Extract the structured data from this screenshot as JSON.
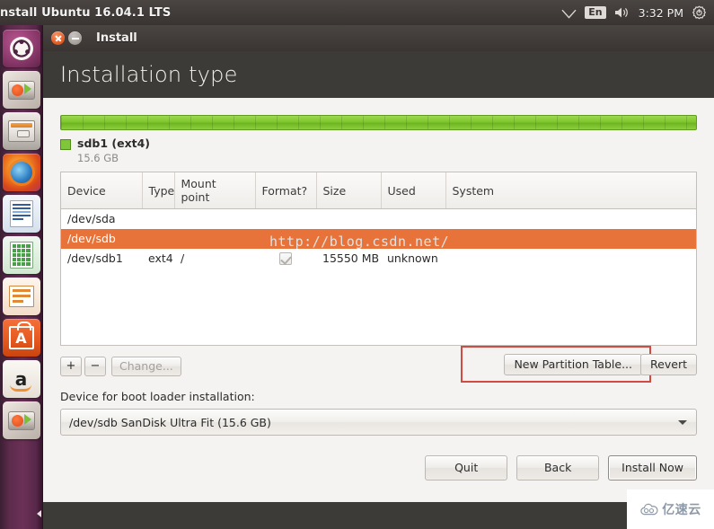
{
  "top_panel": {
    "title": "nstall Ubuntu 16.04.1 LTS",
    "tray": {
      "network_icon": "wifi-icon",
      "keyboard_layout": "En",
      "volume_icon": "volume-icon",
      "clock": "3:32 PM",
      "system_menu_icon": "gear-power-icon"
    }
  },
  "launcher": {
    "items": [
      {
        "name": "ubuntu-dash",
        "label": "Dash home",
        "glyph": "●"
      },
      {
        "name": "install-ubuntu",
        "label": "Install Ubuntu 16.04.1 LTS"
      },
      {
        "name": "files",
        "label": "Files"
      },
      {
        "name": "firefox",
        "label": "Firefox Web Browser"
      },
      {
        "name": "libreoffice-writer",
        "label": "LibreOffice Writer"
      },
      {
        "name": "libreoffice-calc",
        "label": "LibreOffice Calc"
      },
      {
        "name": "libreoffice-impress",
        "label": "LibreOffice Impress"
      },
      {
        "name": "ubuntu-software",
        "label": "Ubuntu Software",
        "glyph": "A"
      },
      {
        "name": "amazon",
        "label": "Amazon",
        "glyph": "a"
      },
      {
        "name": "install-ubuntu-running",
        "label": "Install"
      }
    ]
  },
  "window": {
    "title": "Install",
    "close_icon": "close-icon",
    "minimize_icon": "minimize-icon",
    "page_title": "Installation type"
  },
  "partition_bar": {
    "legend_name": "sdb1 (ext4)",
    "legend_size": "15.6 GB",
    "color": "#7fc63a"
  },
  "table": {
    "headers": [
      "Device",
      "Type",
      "Mount point",
      "Format?",
      "Size",
      "Used",
      "System"
    ],
    "rows": [
      {
        "selected": false,
        "indent": false,
        "device": "/dev/sda",
        "type": "",
        "mount_point": "",
        "format": false,
        "size": "",
        "used": "",
        "system": ""
      },
      {
        "selected": true,
        "indent": false,
        "device": "/dev/sdb",
        "type": "",
        "mount_point": "",
        "format": false,
        "size": "",
        "used": "",
        "system": ""
      },
      {
        "selected": false,
        "indent": true,
        "device": "/dev/sdb1",
        "type": "ext4",
        "mount_point": "/",
        "format": true,
        "size": "15550 MB",
        "used": "unknown",
        "system": ""
      }
    ]
  },
  "watermark_url": "http://blog.csdn.net/",
  "toolbar": {
    "add_label": "+",
    "remove_label": "−",
    "change_label": "Change...",
    "new_partition_table_label": "New Partition Table...",
    "revert_label": "Revert",
    "highlight_color": "#d14b42"
  },
  "bootloader": {
    "label": "Device for boot loader installation:",
    "selected_value": "/dev/sdb   SanDisk Ultra Fit (15.6 GB)",
    "dropdown_icon": "chevron-down-icon"
  },
  "footer": {
    "quit_label": "Quit",
    "back_label": "Back",
    "install_label": "Install Now"
  },
  "watermark_logo": {
    "icon": "cloud-icon",
    "text": "亿速云"
  }
}
